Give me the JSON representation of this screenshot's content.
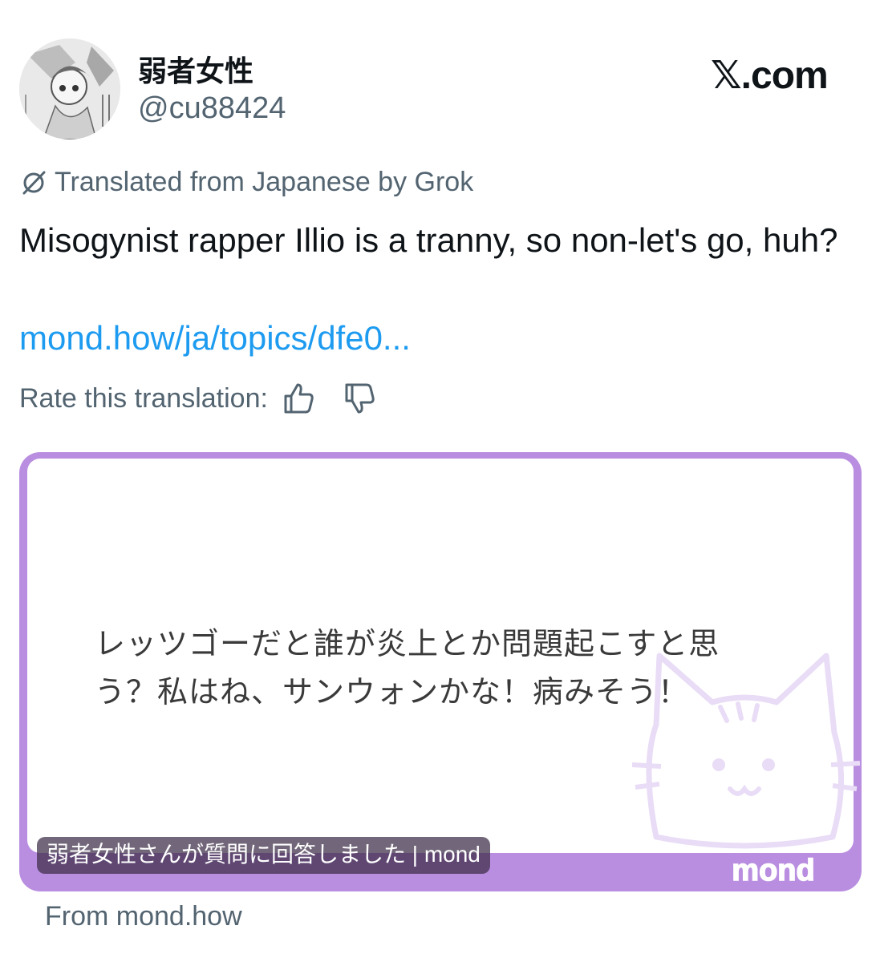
{
  "author": {
    "display_name": "弱者女性",
    "handle": "@cu88424",
    "avatar_icon": "manga-avatar-icon"
  },
  "brand": "𝕏.com",
  "translation": {
    "icon": "grok-icon",
    "note": "Translated from Japanese by Grok",
    "rate_label": "Rate this translation:",
    "thumbs_up_icon": "thumbs-up-icon",
    "thumbs_down_icon": "thumbs-down-icon"
  },
  "tweet": {
    "text": "Misogynist rapper Illio is a tranny, so non-let's go, huh?",
    "link_text": "mond.how/ja/topics/dfe0..."
  },
  "card": {
    "body_text": "レッツゴーだと誰が炎上とか問題起こすと思う？私はね、サンウォンかな！病みそう！",
    "caption": "弱者女性さんが質問に回答しました | mond",
    "logo_text": "mond",
    "border_color": "#b98ee0",
    "source": "From mond.how"
  },
  "colors": {
    "link": "#1d9bf0",
    "secondary_text": "#536471",
    "primary_text": "#0f1419"
  }
}
